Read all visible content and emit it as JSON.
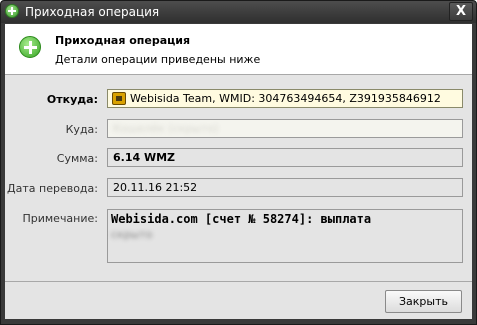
{
  "window": {
    "title": "Приходная операция",
    "close_glyph": "X"
  },
  "header": {
    "title": "Приходная операция",
    "subtitle": "Детали операции приведены ниже",
    "icon": "plus-circle-icon"
  },
  "form": {
    "from_label": "Откуда:",
    "from_value": "Webisida Team, WMID: 304763494654, Z391935846912",
    "to_label": "Куда:",
    "to_value": "Кошелёк (скрыто)",
    "amount_label": "Сумма:",
    "amount_value": "6.14 WMZ",
    "date_label": "Дата перевода:",
    "date_value": "20.11.16 21:52",
    "note_label": "Примечание:",
    "note_line1": "Webisida.com [счет № 58274]: выплата",
    "note_line2": "скрыто"
  },
  "footer": {
    "close_label": "Закрыть"
  },
  "colors": {
    "titlebar": "#3a3a3a",
    "body": "#e4e4e4",
    "from_field": "#fffbe0",
    "accent_green": "#34a321"
  }
}
